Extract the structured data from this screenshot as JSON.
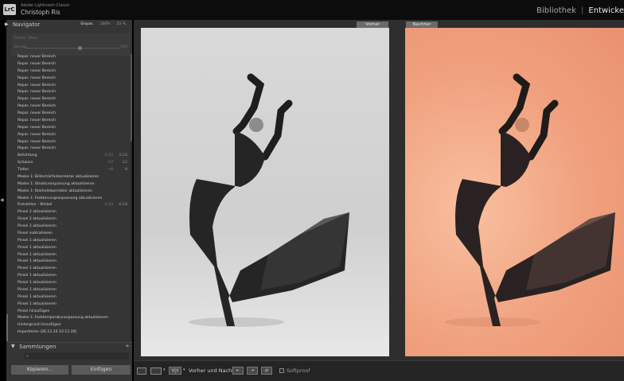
{
  "titlebar": {
    "logo": "LrC",
    "app_name": "Adobe Lightroom Classic",
    "user_name": "Christoph Ris",
    "module_library": "Bibliothek",
    "module_separator": "|",
    "module_develop": "Entwicke"
  },
  "navigator": {
    "title": "Navigator",
    "zoom_options": [
      "Einpas.",
      "100%",
      "25 %"
    ]
  },
  "preset": {
    "label": "Preset: Ohne",
    "min_label": "Betrag",
    "max_label": "100"
  },
  "history": [
    {
      "label": "Repar. neuer Bereich"
    },
    {
      "label": "Repar. neuer Bereich"
    },
    {
      "label": "Repar. neuer Bereich"
    },
    {
      "label": "Repar. neuer Bereich"
    },
    {
      "label": "Repar. neuer Bereich"
    },
    {
      "label": "Repar. neuer Bereich"
    },
    {
      "label": "Repar. neuer Bereich"
    },
    {
      "label": "Repar. neuer Bereich"
    },
    {
      "label": "Repar. neuer Bereich"
    },
    {
      "label": "Repar. neuer Bereich"
    },
    {
      "label": "Repar. neuer Bereich"
    },
    {
      "label": "Repar. neuer Bereich"
    },
    {
      "label": "Repar. neuer Bereich"
    },
    {
      "label": "Repar. neuer Bereich"
    },
    {
      "label": "Belichtung",
      "v1": "-0,10",
      "v2": "0,10"
    },
    {
      "label": "Schwarz",
      "v1": "-12",
      "v2": "-12"
    },
    {
      "label": "Tiefen",
      "v1": "+8",
      "v2": "8"
    },
    {
      "label": "Maske 1: Bildschärfenkorrektor aktualisieren"
    },
    {
      "label": "Maske 1: Strukturanpassung aktualisieren"
    },
    {
      "label": "Maske 1: Klarheitskorrektor aktualisieren"
    },
    {
      "label": "Maske 1: Farbtonungsanpassung aktualisieren"
    },
    {
      "label": "Freistellen - Winkel",
      "v1": "-0,18",
      "v2": "-0,18"
    },
    {
      "label": "Pinsel 2 aktualisieren"
    },
    {
      "label": "Pinsel 2 aktualisieren"
    },
    {
      "label": "Pinsel 2 aktualisieren"
    },
    {
      "label": "Pinsel subtrahieren"
    },
    {
      "label": "Pinsel 1 aktualisieren"
    },
    {
      "label": "Pinsel 1 aktualisieren"
    },
    {
      "label": "Pinsel 1 aktualisieren"
    },
    {
      "label": "Pinsel 1 aktualisieren"
    },
    {
      "label": "Pinsel 1 aktualisieren"
    },
    {
      "label": "Pinsel 1 aktualisieren"
    },
    {
      "label": "Pinsel 1 aktualisieren"
    },
    {
      "label": "Pinsel 1 aktualisieren"
    },
    {
      "label": "Pinsel 1 aktualisieren"
    },
    {
      "label": "Pinsel 1 aktualisieren"
    },
    {
      "label": "Pinsel hinzufügen"
    },
    {
      "label": "Maske 1: Farbtemperaturanpassung aktualisieren"
    },
    {
      "label": "Hintergrund hinzufügen"
    },
    {
      "label": "Importieren (26.12.24 22:11:20)"
    }
  ],
  "collections": {
    "title": "Sammlungen",
    "add": "+"
  },
  "buttons": {
    "copy": "Kopieren...",
    "paste": "Einfügen"
  },
  "compare": {
    "before_label": "Vorher",
    "after_label": "Nachher"
  },
  "toolbar": {
    "view_mode": "Y|Y",
    "before_after_label": "Vorher und Nachher:",
    "softproof_label": "Softproof"
  },
  "colors": {
    "panel": "#353535",
    "background_after": "#f0a07e"
  }
}
